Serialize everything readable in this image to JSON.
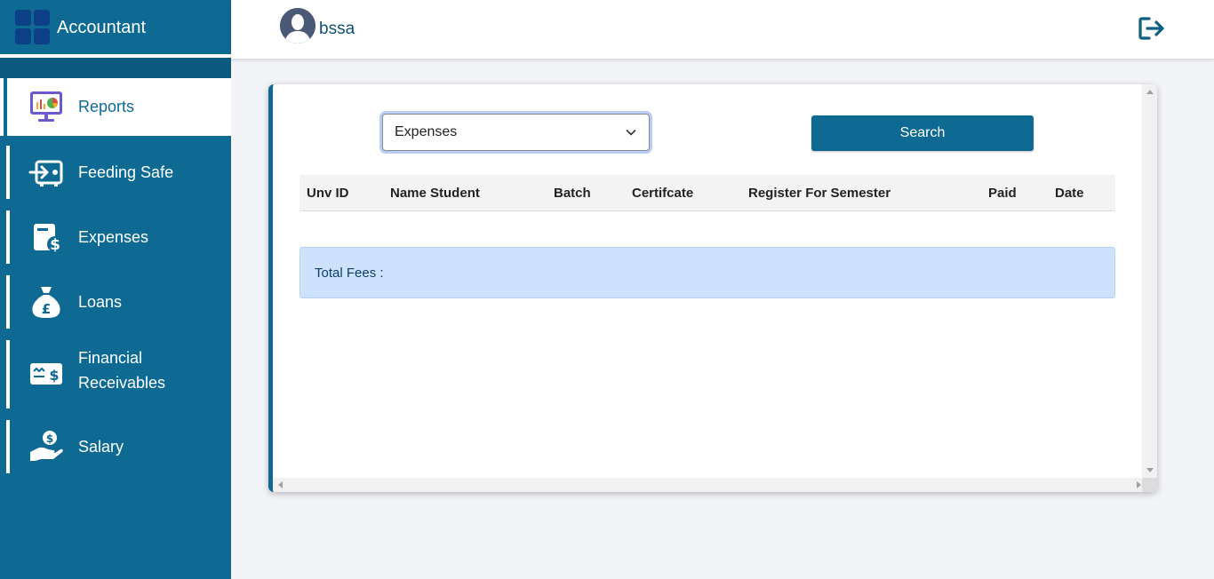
{
  "app": {
    "title": "Accountant"
  },
  "user": {
    "name": "bssa"
  },
  "sidebar": {
    "items": [
      {
        "label": "Reports",
        "icon": "reports-icon",
        "active": true
      },
      {
        "label": "Feeding Safe",
        "icon": "feeding-safe-icon",
        "active": false
      },
      {
        "label": "Expenses",
        "icon": "expenses-icon",
        "active": false
      },
      {
        "label": "Loans",
        "icon": "loans-icon",
        "active": false
      },
      {
        "label": "Financial Receivables",
        "icon": "financial-receivables-icon",
        "active": false
      },
      {
        "label": "Salary",
        "icon": "salary-icon",
        "active": false
      }
    ]
  },
  "filter": {
    "selected": "Expenses"
  },
  "search": {
    "label": "Search"
  },
  "table": {
    "columns": [
      "Unv ID",
      "Name Student",
      "Batch",
      "Certifcate",
      "Register For Semester",
      "Paid",
      "Date"
    ],
    "rows": []
  },
  "total": {
    "label": "Total Fees :"
  },
  "colors": {
    "primary": "#0e6a93",
    "total_bg": "#cfe2fd"
  }
}
